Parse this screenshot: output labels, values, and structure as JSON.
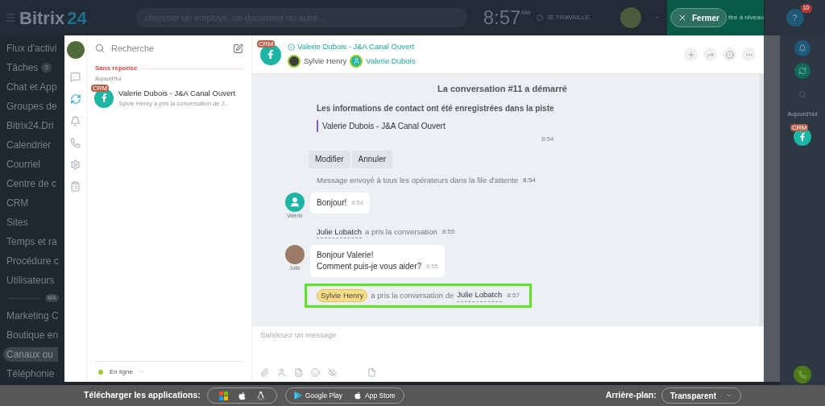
{
  "topbar": {
    "logo_name": "Bitrix",
    "logo_number": "24",
    "search_placeholder": "chercher un employé, un document ou autre...",
    "clock": "8:57",
    "clock_suffix": "AM",
    "status": "JE TRAVAILLE",
    "help": "?",
    "upgrade": "ttre à niveau",
    "close_button": "Fermer",
    "help_badge": "10"
  },
  "menu": [
    {
      "label": "Flux d'activi",
      "selected": false
    },
    {
      "label": "Tâches",
      "badge": "3",
      "selected": false
    },
    {
      "label": "Chat et App",
      "selected": false
    },
    {
      "label": "Groupes de",
      "selected": false
    },
    {
      "label": "Bitrix24.Dri",
      "selected": false
    },
    {
      "label": "Calendrier",
      "selected": false
    },
    {
      "label": "Courriel",
      "selected": false
    },
    {
      "label": "Centre de c",
      "selected": false
    },
    {
      "label": "CRM",
      "selected": false
    },
    {
      "label": "Sites",
      "selected": false
    },
    {
      "label": "Temps et ra",
      "selected": false
    },
    {
      "label": "Procédure c",
      "selected": false
    },
    {
      "label": "Utilisateurs",
      "selected": false
    },
    {
      "kind": "divider",
      "label": "MA"
    },
    {
      "label": "Marketing C",
      "selected": false
    },
    {
      "label": "Boutique en",
      "selected": false
    },
    {
      "label": "Canaux ou",
      "selected": true
    },
    {
      "label": "Téléphonie",
      "selected": false
    }
  ],
  "rail": [
    {
      "kind": "chat",
      "selected": false
    },
    {
      "kind": "openlines",
      "selected": true
    },
    {
      "kind": "bell",
      "selected": false
    },
    {
      "kind": "phone",
      "selected": false
    },
    {
      "kind": "settings",
      "selected": false
    },
    {
      "kind": "notes",
      "selected": false
    }
  ],
  "list": {
    "search_placeholder": "Recherche",
    "section": "Sans réponse",
    "date": "Aujourd'hui",
    "items": [
      {
        "title": "Valerie Dubois - J&A Canal Ouvert",
        "preview": "Sylvie Henry a pris la conversation de J...",
        "badge": "CRM"
      }
    ],
    "status": "En ligne"
  },
  "chat": {
    "title": "Valerie Dubois - J&A Canal Ouvert",
    "badge": "CRM",
    "participants": [
      {
        "name": "Sylvie Henry",
        "kind": "operator"
      },
      {
        "name": "Valerie Dubois",
        "kind": "client"
      }
    ],
    "messages": [
      {
        "kind": "header",
        "text": "La conversation **#11** a démarré"
      },
      {
        "kind": "contact",
        "text": "Les informations de contact ont été enregistrées dans la piste",
        "quote": "Valerie Dubois - J&A Canal Ouvert",
        "time": "8:54"
      },
      {
        "kind": "buttons",
        "buttons": [
          "Modifier",
          "Annuler"
        ]
      },
      {
        "kind": "notice",
        "text": "Message envoyé à tous les opérateurs dans la file d'attente",
        "time": "8:54"
      },
      {
        "kind": "bubble",
        "author": "Valerie",
        "avatar": {
          "kind": "icon"
        },
        "lines": [
          "Bonjour!"
        ],
        "time": "8:54"
      },
      {
        "kind": "event",
        "highlighted": false,
        "parts": [
          {
            "text": "Julie Lobatch",
            "kind": "link"
          },
          {
            "text": "a pris la conversation",
            "kind": "plain"
          }
        ],
        "time": "8:55"
      },
      {
        "kind": "bubble",
        "author": "Julie",
        "avatar": {
          "kind": "photo"
        },
        "lines": [
          "Bonjour Valerie!",
          "Comment puis-je vous aider?"
        ],
        "time": "8:55"
      },
      {
        "kind": "event",
        "highlighted": true,
        "parts": [
          {
            "text": "Sylvie Henry",
            "kind": "chip"
          },
          {
            "text": "a pris la conversation de",
            "kind": "plain"
          },
          {
            "text": "Julie Lobatch",
            "kind": "link"
          }
        ],
        "time": "8:57"
      }
    ],
    "input_placeholder": "Saisissez un message"
  },
  "right": {
    "today": "Aujourd'hui",
    "badge": "CRM"
  },
  "bottom": {
    "label": "Télécharger les applications:",
    "stores": [
      "Google Play",
      "App Store"
    ],
    "background_label": "Arrière-plan:",
    "background_value": "Transparent"
  }
}
